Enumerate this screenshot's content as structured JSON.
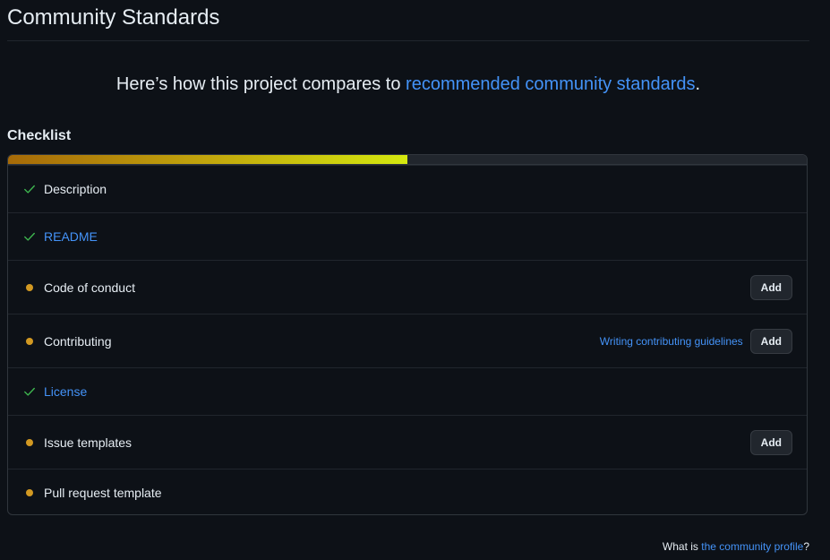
{
  "page": {
    "title": "Community Standards",
    "intro_prefix": "Here’s how this project compares to ",
    "intro_link": "recommended community standards",
    "intro_suffix": "."
  },
  "checklist": {
    "heading": "Checklist",
    "progress_fraction": 0.5,
    "colors": {
      "check": "#3fb950",
      "pending": "#d29922",
      "link": "#4493f8"
    },
    "items": [
      {
        "label": "Description",
        "status": "done",
        "is_link": false,
        "icon": "check-icon"
      },
      {
        "label": "README",
        "status": "done",
        "is_link": true,
        "icon": "check-icon"
      },
      {
        "label": "Code of conduct",
        "status": "pending",
        "is_link": false,
        "icon": "dot-icon",
        "button": "Add"
      },
      {
        "label": "Contributing",
        "status": "pending",
        "is_link": false,
        "icon": "dot-icon",
        "guide_link": "Writing contributing guidelines",
        "button": "Add"
      },
      {
        "label": "License",
        "status": "done",
        "is_link": true,
        "icon": "check-icon"
      },
      {
        "label": "Issue templates",
        "status": "pending",
        "is_link": false,
        "icon": "dot-icon",
        "button": "Add"
      },
      {
        "label": "Pull request template",
        "status": "pending",
        "is_link": false,
        "icon": "dot-icon"
      }
    ]
  },
  "footer": {
    "prefix": "What is ",
    "link": "the community profile",
    "suffix": "?"
  }
}
